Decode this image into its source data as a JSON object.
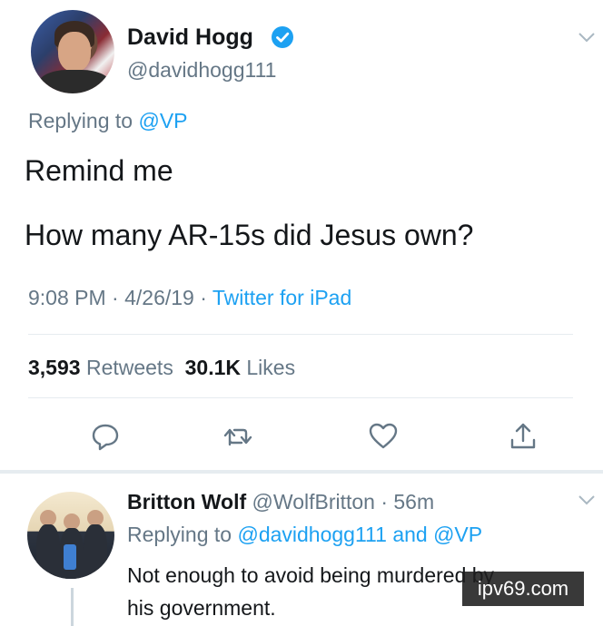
{
  "tweet": {
    "author_name": "David Hogg",
    "author_handle": "@davidhogg111",
    "replying_prefix": "Replying to ",
    "replying_to": "@VP",
    "line1": "Remind me",
    "line2": "How many AR-15s did Jesus own?",
    "meta_time": "9:08 PM · 4/26/19 · ",
    "meta_source": "Twitter for iPad",
    "retweets_count": "3,593",
    "retweets_label": " Retweets",
    "likes_count": "30.1K",
    "likes_label": " Likes"
  },
  "reply": {
    "author_name": "Britton Wolf",
    "author_handle": " @WolfBritton · 56m",
    "replying_prefix": "Replying to ",
    "replying_to": "@davidhogg111 and @VP",
    "line1": "Not enough to avoid being murdered by",
    "line2": "his government."
  },
  "watermark": "ipv69.com",
  "icons": {
    "reply": "reply-icon",
    "retweet": "retweet-icon",
    "like": "heart-icon",
    "share": "share-icon",
    "verified": "verified-badge-icon",
    "chevron": "chevron-down-icon"
  },
  "colors": {
    "link": "#1da1f2",
    "muted": "#657786",
    "text": "#14171a"
  }
}
